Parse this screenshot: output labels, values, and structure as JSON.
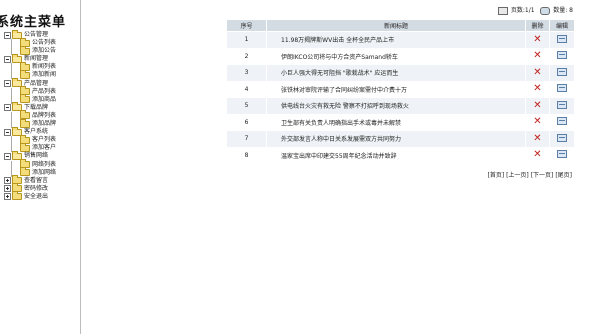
{
  "sidebar": {
    "title": "系统主菜单",
    "groups": [
      {
        "label": "公告管理",
        "items": [
          "公告列表",
          "添加公告"
        ]
      },
      {
        "label": "新闻管理",
        "items": [
          "新闻列表",
          "添加新闻"
        ]
      },
      {
        "label": "产品管理",
        "items": [
          "产品列表",
          "添加商品"
        ]
      },
      {
        "label": "下载品牌",
        "items": [
          "品牌列表",
          "添加品牌"
        ]
      },
      {
        "label": "客户系统",
        "items": [
          "客户列表",
          "添加客户"
        ]
      },
      {
        "label": "销售网络",
        "items": [
          "网络列表",
          "添加网络"
        ]
      },
      {
        "label": "查看留言",
        "items": []
      },
      {
        "label": "密码修改",
        "items": []
      },
      {
        "label": "安全退出",
        "items": []
      }
    ]
  },
  "topbar": {
    "pages_label": "页数:1/1",
    "count_label": "数量: 8"
  },
  "table": {
    "headers": [
      "序号",
      "新闻标题",
      "删除",
      "编辑"
    ],
    "rows": [
      {
        "no": "1",
        "title": "11.98万揭牌斯WV出击 全杯全民产品上市"
      },
      {
        "no": "2",
        "title": "伊朗IKCO公司将与中方合资产Samand轿车"
      },
      {
        "no": "3",
        "title": "小巨人强大得无可阻挡 \"歌栽战术\" 应运而生"
      },
      {
        "no": "4",
        "title": "张铁林对审院评输了合同纠纷案需付中介费十万"
      },
      {
        "no": "5",
        "title": "供电线台火灾有救无险 警察不打招呼到现场救火"
      },
      {
        "no": "6",
        "title": "卫生部有关负责人明确指出手术或毒并未解禁"
      },
      {
        "no": "7",
        "title": "外交部发言人称中日关系发展需双方共同努力"
      },
      {
        "no": "8",
        "title": "温家宝出席中印建交55周年纪念活动并致辞"
      }
    ]
  },
  "pager": {
    "first": "[首页]",
    "prev": "[上一页]",
    "next": "[下一页]",
    "last": "[尾页]"
  },
  "colors": {
    "header_bg": "#d3dbe3",
    "row_alt_bg": "#eff3f7",
    "delete_icon": "#c0201d"
  }
}
